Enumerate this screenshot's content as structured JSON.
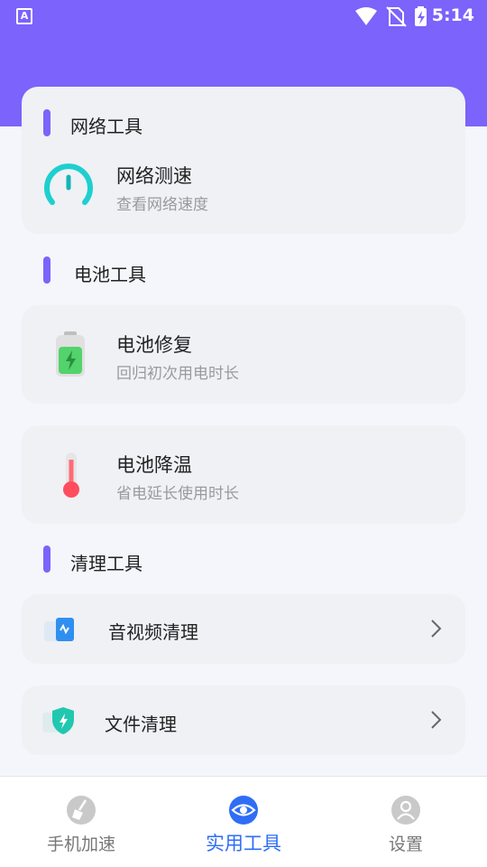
{
  "status_bar": {
    "time": "5:14",
    "app_icon_letter": "A"
  },
  "sections": {
    "network": {
      "title": "网络工具",
      "items": [
        {
          "title": "网络测速",
          "subtitle": "查看网络速度",
          "icon": "speedometer-icon"
        }
      ]
    },
    "battery": {
      "title": "电池工具",
      "items": [
        {
          "title": "电池修复",
          "subtitle": "回归初次用电时长",
          "icon": "battery-icon"
        },
        {
          "title": "电池降温",
          "subtitle": "省电延长使用时长",
          "icon": "thermometer-icon"
        }
      ]
    },
    "clean": {
      "title": "清理工具",
      "items": [
        {
          "title": "音视频清理",
          "icon": "media-file-icon"
        },
        {
          "title": "文件清理",
          "icon": "shield-icon"
        }
      ]
    }
  },
  "tabbar": {
    "tabs": [
      {
        "label": "手机加速",
        "icon": "broom-icon",
        "active": false
      },
      {
        "label": "实用工具",
        "icon": "eye-icon",
        "active": true
      },
      {
        "label": "设置",
        "icon": "user-icon",
        "active": false
      }
    ]
  },
  "colors": {
    "accent": "#7b63fb",
    "active_tab": "#2f6df6",
    "card_bg": "#eff1f5"
  }
}
